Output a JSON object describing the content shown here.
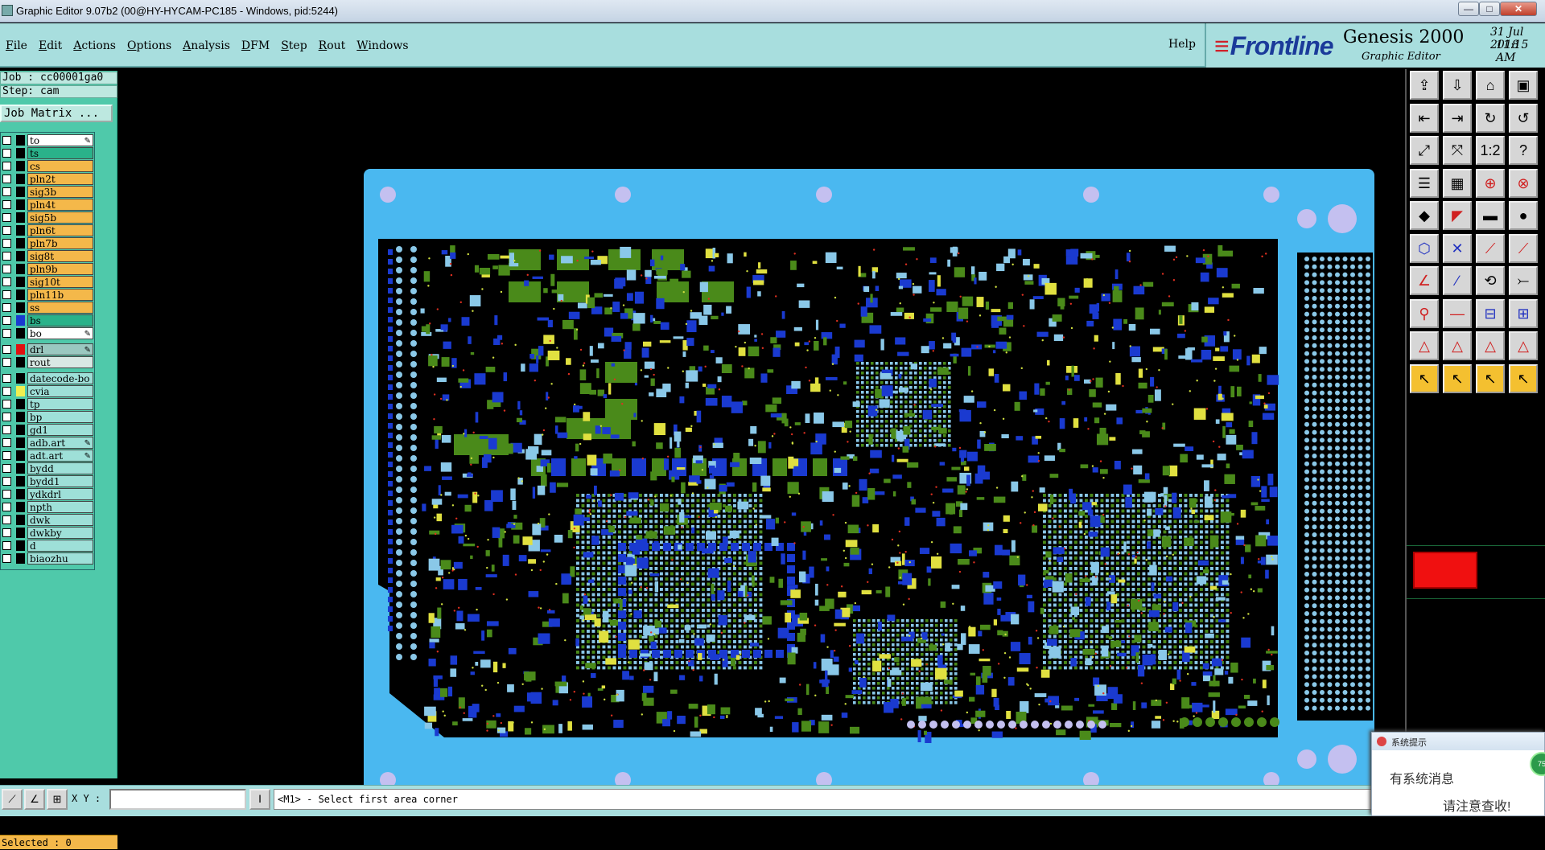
{
  "window": {
    "title": "Graphic Editor 9.07b2 (00@HY-HYCAM-PC185 - Windows, pid:5244)",
    "min_label": "—",
    "max_label": "□",
    "close_label": "✕"
  },
  "menu": {
    "items": [
      "File",
      "Edit",
      "Actions",
      "Options",
      "Analysis",
      "DFM",
      "Step",
      "Rout",
      "Windows"
    ],
    "help": "Help"
  },
  "brand": {
    "logo": "Frontline",
    "product": "Genesis 2000",
    "subtitle": "Graphic Editor",
    "date": "31 Jul 2018",
    "time": "11:15 AM"
  },
  "job": {
    "job_line": "Job : cc00001ga0",
    "step_line": "Step: cam",
    "matrix_button": "Job Matrix ..."
  },
  "layers": [
    {
      "name": "to",
      "swatch": "#000000",
      "bg": "#ffffff",
      "pin": true
    },
    {
      "name": "ts",
      "swatch": "#000000",
      "bg": "#2ab28a",
      "pin": false
    },
    {
      "name": "cs",
      "swatch": "#000000",
      "bg": "#f4b84a",
      "pin": false
    },
    {
      "name": "pln2t",
      "swatch": "#000000",
      "bg": "#f4b84a",
      "pin": false
    },
    {
      "name": "sig3b",
      "swatch": "#000000",
      "bg": "#f4b84a",
      "pin": false
    },
    {
      "name": "pln4t",
      "swatch": "#000000",
      "bg": "#f4b84a",
      "pin": false
    },
    {
      "name": "sig5b",
      "swatch": "#000000",
      "bg": "#f4b84a",
      "pin": false
    },
    {
      "name": "pln6t",
      "swatch": "#000000",
      "bg": "#f4b84a",
      "pin": false
    },
    {
      "name": "pln7b",
      "swatch": "#000000",
      "bg": "#f4b84a",
      "pin": false
    },
    {
      "name": "sig8t",
      "swatch": "#000000",
      "bg": "#f4b84a",
      "pin": false
    },
    {
      "name": "pln9b",
      "swatch": "#000000",
      "bg": "#f4b84a",
      "pin": false
    },
    {
      "name": "sig10t",
      "swatch": "#000000",
      "bg": "#f4b84a",
      "pin": false
    },
    {
      "name": "pln11b",
      "swatch": "#000000",
      "bg": "#f4b84a",
      "pin": false
    },
    {
      "name": "ss",
      "swatch": "#000000",
      "bg": "#f4b84a",
      "pin": false
    },
    {
      "name": "bs",
      "swatch": "#1a3ad0",
      "bg": "#2ab28a",
      "pin": false
    },
    {
      "name": "bo",
      "swatch": "#000000",
      "bg": "#ffffff",
      "pin": true
    },
    {
      "name": "drl",
      "swatch": "#e01010",
      "bg": "#9ac8c0",
      "pin": true
    },
    {
      "name": "rout",
      "swatch": "#000000",
      "bg": "#d8e8e4",
      "pin": false
    },
    {
      "name": "datecode-bo",
      "swatch": "#000000",
      "bg": "#9ee0d8",
      "pin": false
    },
    {
      "name": "cvia",
      "swatch": "#f0f050",
      "bg": "#9ee0d8",
      "pin": false
    },
    {
      "name": "tp",
      "swatch": "#000000",
      "bg": "#9ee0d8",
      "pin": false
    },
    {
      "name": "bp",
      "swatch": "#000000",
      "bg": "#9ee0d8",
      "pin": false
    },
    {
      "name": "gd1",
      "swatch": "#000000",
      "bg": "#9ee0d8",
      "pin": false
    },
    {
      "name": "adb.art",
      "swatch": "#000000",
      "bg": "#9ee0d8",
      "pin": true
    },
    {
      "name": "adt.art",
      "swatch": "#000000",
      "bg": "#9ee0d8",
      "pin": true
    },
    {
      "name": "bydd",
      "swatch": "#000000",
      "bg": "#9ee0d8",
      "pin": false
    },
    {
      "name": "bydd1",
      "swatch": "#000000",
      "bg": "#9ee0d8",
      "pin": false
    },
    {
      "name": "ydkdrl",
      "swatch": "#000000",
      "bg": "#9ee0d8",
      "pin": false
    },
    {
      "name": "npth",
      "swatch": "#000000",
      "bg": "#9ee0d8",
      "pin": false
    },
    {
      "name": "dwk",
      "swatch": "#000000",
      "bg": "#9ee0d8",
      "pin": false
    },
    {
      "name": "dwkby",
      "swatch": "#000000",
      "bg": "#9ee0d8",
      "pin": false
    },
    {
      "name": "d",
      "swatch": "#000000",
      "bg": "#9ee0d8",
      "pin": false
    },
    {
      "name": "biaozhu",
      "swatch": "#000000",
      "bg": "#9ee0d8",
      "pin": false
    }
  ],
  "status": {
    "selected": "Selected : 0",
    "xy_label": "X Y :",
    "xy_value": "",
    "message": "<M1> - Select first area corner"
  },
  "colors": {
    "board_border": "#4ab8f0",
    "copper_green": "#4a8a1a",
    "pad_blue": "#1a3ad0",
    "pad_light": "#8ac8e8",
    "mount_hole": "#c4c0f0"
  },
  "notification": {
    "title": "系统提示",
    "line1": "有系统消息",
    "line2": "请注意查收!",
    "badge": "75"
  }
}
